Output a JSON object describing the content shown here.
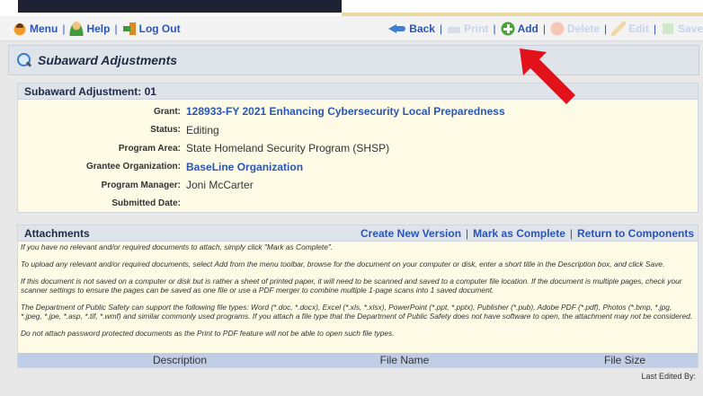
{
  "toolbar": {
    "left": [
      {
        "label": "Menu",
        "icon": "menu-icon"
      },
      {
        "label": "Help",
        "icon": "help-icon"
      },
      {
        "label": "Log Out",
        "icon": "logout-icon"
      }
    ],
    "right": [
      {
        "label": "Back",
        "icon": "back-icon",
        "enabled": true
      },
      {
        "label": "Print",
        "icon": "print-icon",
        "enabled": false
      },
      {
        "label": "Add",
        "icon": "add-icon",
        "enabled": true
      },
      {
        "label": "Delete",
        "icon": "delete-icon",
        "enabled": false
      },
      {
        "label": "Edit",
        "icon": "edit-icon",
        "enabled": false
      },
      {
        "label": "Save",
        "icon": "save-icon",
        "enabled": false
      }
    ],
    "separator": "|"
  },
  "page": {
    "title": "Subaward Adjustments",
    "icon": "magnifier-icon"
  },
  "details": {
    "header": "Subaward Adjustment: 01",
    "fields": [
      {
        "label": "Grant:",
        "value": "128933-FY 2021 Enhancing Cybersecurity Local Preparedness",
        "link": true
      },
      {
        "label": "Status:",
        "value": "Editing",
        "link": false
      },
      {
        "label": "Program Area:",
        "value": "State Homeland Security Program (SHSP)",
        "link": false
      },
      {
        "label": "Grantee Organization:",
        "value": "BaseLine Organization",
        "link": true
      },
      {
        "label": "Program Manager:",
        "value": "Joni McCarter",
        "link": false
      },
      {
        "label": "Submitted Date:",
        "value": "",
        "link": false
      }
    ]
  },
  "attachments": {
    "header": "Attachments",
    "links": [
      "Create New Version",
      "Mark as Complete",
      "Return to Components"
    ],
    "notes": [
      "If you have no relevant and/or required documents to attach, simply click \"Mark as Complete\".",
      "To upload any relevant and/or required documents, select Add from the menu toolbar, browse for the document on your computer or disk, enter a short title in the Description box, and click Save.",
      "If this document is not saved on a computer or disk but is rather a sheet of printed paper, it will need to be scanned and saved to a computer file location. If the document is multiple pages, check your scanner settings to ensure the pages can be saved as one file or use a PDF merger to combine multiple 1-page scans into 1 saved document.",
      "The Department of Public Safety can support the following file types: Word (*.doc, *.docx), Excel (*.xls, *.xlsx), PowerPoint (*.ppt, *.pptx), Publisher (*.pub), Adobe PDF (*.pdf), Photos (*.bmp, *.jpg, *.jpeg, *.jpe, *.asp, *.tif, *.wmf) and similar commonly used programs. If you attach a file type that the Department of Public Safety does not have software to open, the attachment may not be considered.",
      "Do not attach password protected documents as the Print to PDF feature will not be able to open such file types."
    ],
    "columns": [
      "Description",
      "File Name",
      "File Size"
    ]
  },
  "footer": {
    "last_edited_label": "Last Edited By:"
  },
  "colors": {
    "link": "#2a55b8",
    "panel_bg": "#fdfbe6",
    "header_bg": "#dfe3ea",
    "table_head_bg": "#c0cde6",
    "arrow": "#e3111a"
  }
}
